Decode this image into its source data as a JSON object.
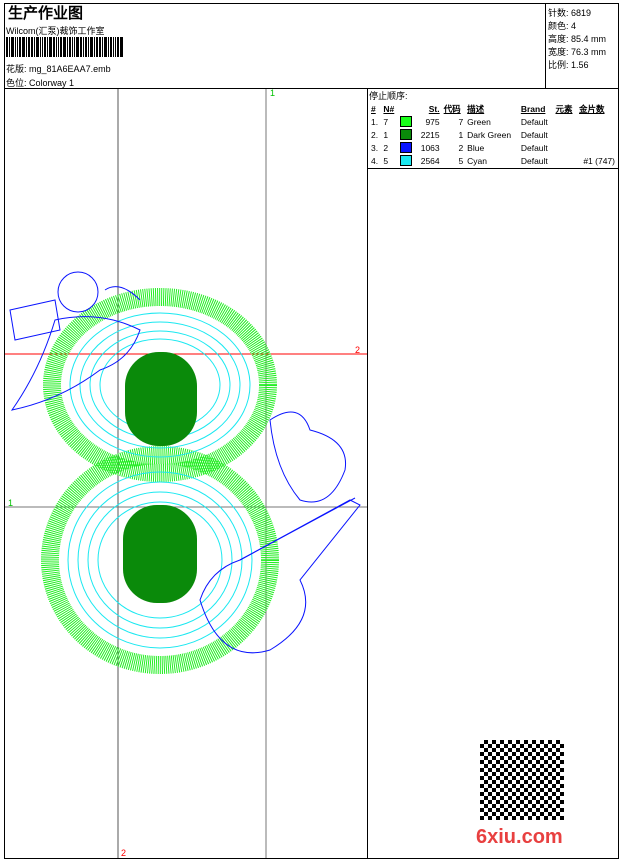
{
  "header": {
    "title": "生产作业图",
    "company": "Wilcom(汇泵)裁饰工作室",
    "design_label": "花版:",
    "design_value": "mg_81A6EAA7.emb",
    "colorway_label": "色位:",
    "colorway_value": "Colorway 1"
  },
  "info": [
    {
      "label": "针数:",
      "value": "6819"
    },
    {
      "label": "颜色:",
      "value": "4"
    },
    {
      "label": "高度:",
      "value": "85.4 mm"
    },
    {
      "label": "宽度:",
      "value": "76.3 mm"
    },
    {
      "label": "比例:",
      "value": "1.56"
    }
  ],
  "stop_sequence": {
    "title": "停止顺序:",
    "columns": [
      "#",
      "N#",
      "St.",
      "代码",
      "描述",
      "Brand",
      "元素",
      "金片数"
    ],
    "rows": [
      {
        "idx": "1.",
        "n": "7",
        "color": "#1aff1a",
        "st": "975",
        "code": "7",
        "desc": "Green",
        "brand": "Default",
        "elem": "",
        "sequin": ""
      },
      {
        "idx": "2.",
        "n": "1",
        "color": "#0a8a0a",
        "st": "2215",
        "code": "1",
        "desc": "Dark Green",
        "brand": "Default",
        "elem": "",
        "sequin": ""
      },
      {
        "idx": "3.",
        "n": "2",
        "color": "#0a14ff",
        "st": "1063",
        "code": "2",
        "desc": "Blue",
        "brand": "Default",
        "elem": "",
        "sequin": ""
      },
      {
        "idx": "4.",
        "n": "5",
        "color": "#1ae8f0",
        "st": "2564",
        "code": "5",
        "desc": "Cyan",
        "brand": "Default",
        "elem": "",
        "sequin": "#1 (747)"
      }
    ]
  },
  "axes": {
    "top": "1",
    "right": "2",
    "left": "1",
    "bottom": "2"
  },
  "watermark": "6xiu.com"
}
